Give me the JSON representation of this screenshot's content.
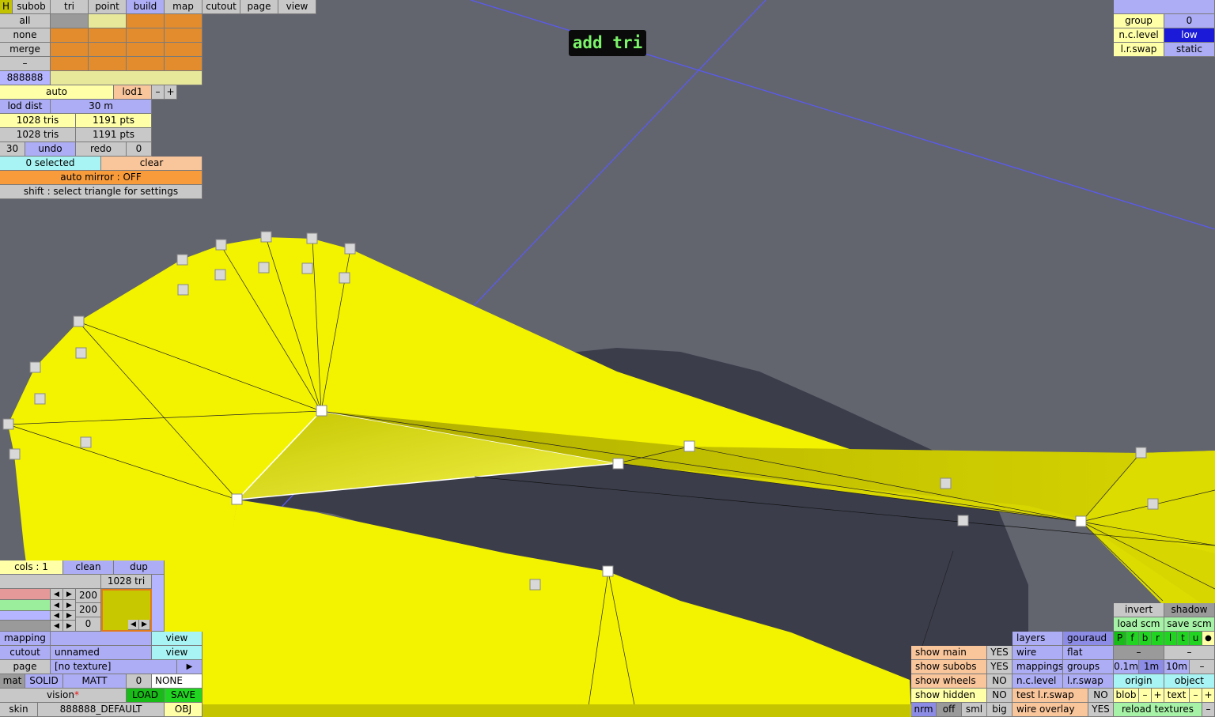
{
  "mode_title": "add tri",
  "menu_tabs": [
    "H",
    "subob",
    "tri",
    "point",
    "build",
    "map",
    "cutout",
    "page",
    "view"
  ],
  "selection_rows": [
    "all",
    "none",
    "merge",
    "–"
  ],
  "color_code": "888888",
  "lod": {
    "mode": "auto",
    "name": "lod1",
    "minus": "–",
    "plus": "+",
    "dist_label": "lod dist",
    "dist_value": "30 m"
  },
  "stats": {
    "tris_1": "1028 tris",
    "pts_1": "1191 pts",
    "tris_2": "1028 tris",
    "pts_2": "1191 pts"
  },
  "history": {
    "count": "30",
    "undo": "undo",
    "redo": "redo",
    "redo_count": "0"
  },
  "selected": {
    "label": "0 selected",
    "clear": "clear"
  },
  "auto_mirror": "auto mirror : OFF",
  "hint": "shift : select triangle for settings",
  "top_right": {
    "group_label": "group",
    "group_value": "0",
    "nc_label": "n.c.level",
    "nc_value": "low",
    "lr_label": "l.r.swap",
    "lr_value": "static"
  },
  "bottom_left": {
    "cols_label": "cols : 1",
    "clean": "clean",
    "dup": "dup",
    "tri_count": "1028 tri",
    "rgb": [
      "200",
      "200",
      "0"
    ],
    "mapping_label": "mapping",
    "mapping_view": "view",
    "cutout_label": "cutout",
    "cutout_value": "unnamed",
    "cutout_view": "view",
    "page_label": "page",
    "page_value": "[no texture]",
    "page_arrow": "▶",
    "mat_label": "mat",
    "mat_solid": "SOLID",
    "mat_matt": "MATT",
    "mat_num": "0",
    "mat_none": "NONE",
    "vision_label": "vision",
    "vision_star": "*",
    "load": "LOAD",
    "save": "SAVE",
    "skin_label": "skin",
    "skin_value": "888888_DEFAULT",
    "skin_obj": "OBJ"
  },
  "bottom_right": {
    "show_main": "show main",
    "show_main_v": "YES",
    "show_subobs": "show subobs",
    "show_subobs_v": "YES",
    "show_wheels": "show wheels",
    "show_wheels_v": "NO",
    "show_hidden": "show hidden",
    "show_hidden_v": "NO",
    "nrm": "nrm",
    "off": "off",
    "sml": "sml",
    "big": "big",
    "layers": "layers",
    "gouraud": "gouraud",
    "wire": "wire",
    "flat": "flat",
    "mappings": "mappings",
    "groups": "groups",
    "nc_level": "n.c.level",
    "lr_swap": "l.r.swap",
    "test_lr": "test l.r.swap",
    "test_lr_v": "NO",
    "wire_overlay": "wire overlay",
    "wire_overlay_v": "YES",
    "invert": "invert",
    "shadow": "shadow",
    "load_scm": "load scm",
    "save_scm": "save scm",
    "flags": [
      "P",
      "f",
      "b",
      "r",
      "l",
      "t",
      "u",
      "●"
    ],
    "dash1": "–",
    "dash2": "–",
    "s01": "0.1m",
    "s1": "1m",
    "s10": "10m",
    "sdash": "–",
    "origin": "origin",
    "object": "object",
    "blob": "blob",
    "text": "text",
    "pm_minus": "–",
    "pm_plus": "+",
    "reload": "reload textures",
    "reload_dash": "–"
  },
  "colors": {
    "background": "#62646e",
    "mesh_yellow": "#f3f300",
    "shadow_mesh": "#3b3d4b",
    "grid_line": "#5a5af0"
  }
}
